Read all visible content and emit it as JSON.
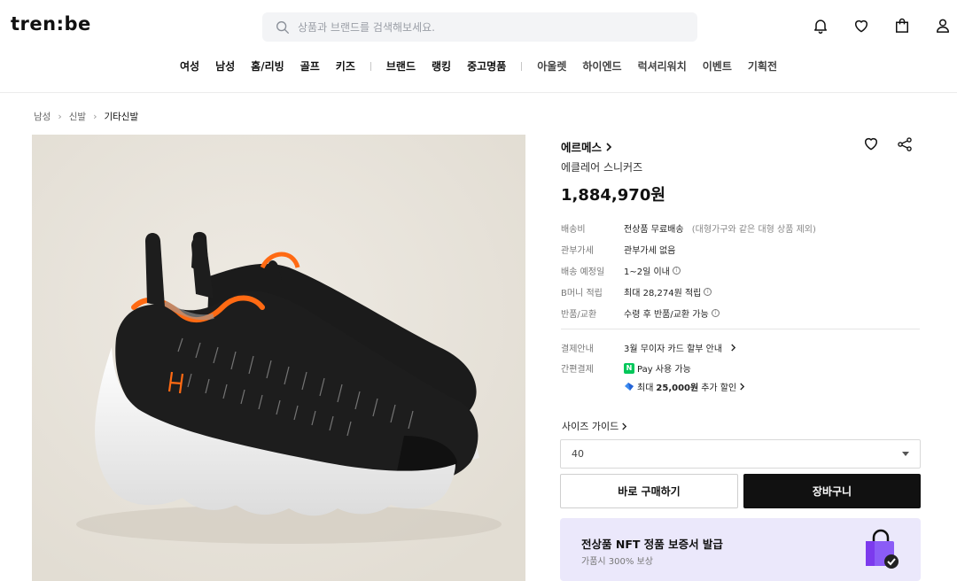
{
  "header": {
    "logo": "tren:be",
    "search_placeholder": "상품과 브랜드를 검색해보세요."
  },
  "nav": {
    "group1": [
      "여성",
      "남성",
      "홈/리빙",
      "골프",
      "키즈"
    ],
    "group2": [
      "브랜드",
      "랭킹",
      "중고명품"
    ],
    "group3": [
      "아울렛",
      "하이엔드",
      "럭셔리워치",
      "이벤트",
      "기획전"
    ]
  },
  "breadcrumb": [
    "남성",
    "신발",
    "기타신발"
  ],
  "product": {
    "brand": "에르메스",
    "name": "에클레어 스니커즈",
    "price": "1,884,970원"
  },
  "info": {
    "shipping_label": "배송비",
    "shipping_value": "전상품 무료배송",
    "shipping_note": "(대형가구와 같은 대형 상품 제외)",
    "customs_label": "관부가세",
    "customs_value": "관부가세 없음",
    "delivery_label": "배송 예정일",
    "delivery_value": "1~2일 이내",
    "bmoney_label": "B머니 적립",
    "bmoney_value": "최대 28,274원 적립",
    "return_label": "반품/교환",
    "return_value": "수령 후 반품/교환 가능",
    "payment_label": "결제안내",
    "payment_value": "3월 무이자 카드 할부 안내",
    "easypay_label": "간편결제",
    "npay_value": "Pay 사용 가능",
    "npay_badge": "N",
    "discount_prefix": "최대",
    "discount_amount": "25,000원",
    "discount_suffix": "추가 할인"
  },
  "size": {
    "guide_label": "사이즈 가이드",
    "selected": "40"
  },
  "buttons": {
    "buy": "바로 구매하기",
    "cart": "장바구니"
  },
  "nft": {
    "title": "전상품 NFT 정품 보증서 발급",
    "subtitle": "가품시 300% 보상"
  },
  "colors": {
    "accent_dark": "#111111",
    "nft_bg": "#ebe8fb",
    "npay_green": "#03c75a",
    "shoe_orange": "#ff6a13"
  }
}
